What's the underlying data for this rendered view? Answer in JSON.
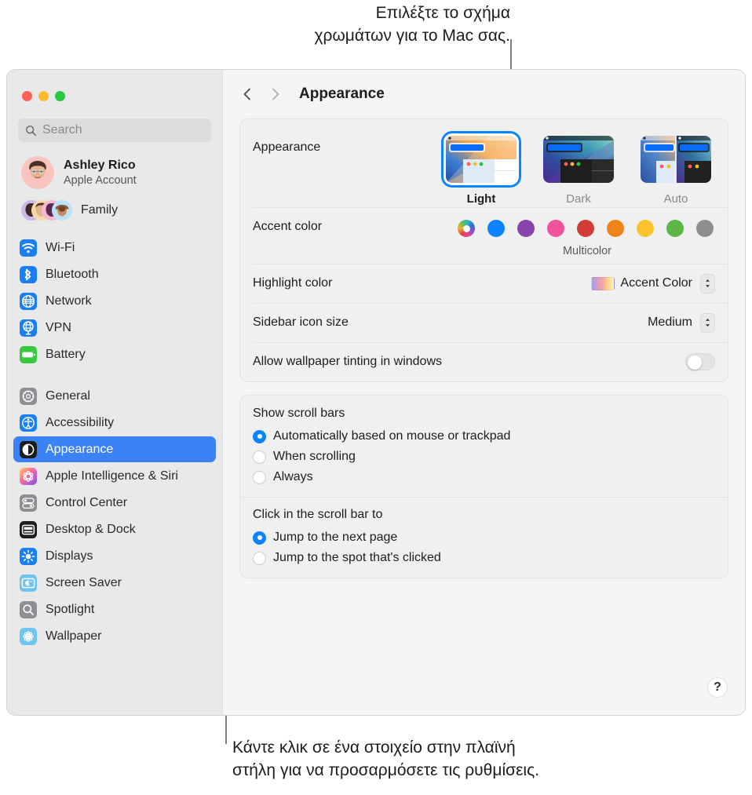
{
  "annotations": {
    "top": "Επιλέξτε το σχήμα\nχρωμάτων για το Mac σας.",
    "bottom": "Κάντε κλικ σε ένα στοιχείο στην πλαϊνή\nστήλη για να προσαρμόσετε τις ρυθμίσεις."
  },
  "window": {
    "traffic_lights": [
      "close-red",
      "minimize-yellow",
      "maximize-green"
    ]
  },
  "sidebar": {
    "search": {
      "placeholder": "Search",
      "value": "",
      "icon": "search-icon"
    },
    "account": {
      "name": "Ashley Rico",
      "subtitle": "Apple Account",
      "avatar": "memoji-avatar"
    },
    "family": {
      "label": "Family",
      "avatar": "family-memoji-stack"
    },
    "groups": [
      {
        "items": [
          {
            "label": "Wi-Fi",
            "icon": "wifi-icon",
            "color": "#1a7ef5",
            "selected": false
          },
          {
            "label": "Bluetooth",
            "icon": "bluetooth-icon",
            "color": "#1a7ef5",
            "selected": false
          },
          {
            "label": "Network",
            "icon": "network-globe-icon",
            "color": "#1a7ef5",
            "selected": false
          },
          {
            "label": "VPN",
            "icon": "vpn-globe-icon",
            "color": "#1a7ef5",
            "selected": false
          },
          {
            "label": "Battery",
            "icon": "battery-icon",
            "color": "#37c840",
            "selected": false
          }
        ]
      },
      {
        "items": [
          {
            "label": "General",
            "icon": "gear-icon",
            "color": "#8e8e93",
            "selected": false
          },
          {
            "label": "Accessibility",
            "icon": "accessibility-icon",
            "color": "#1a7ef5",
            "selected": false
          },
          {
            "label": "Appearance",
            "icon": "appearance-contrast-icon",
            "color": "#1d1d1f",
            "selected": true
          },
          {
            "label": "Apple Intelligence & Siri",
            "icon": "apple-intelligence-icon",
            "color": "#ff4d94",
            "selected": false
          },
          {
            "label": "Control Center",
            "icon": "control-center-icon",
            "color": "#8e8e93",
            "selected": false
          },
          {
            "label": "Desktop & Dock",
            "icon": "desktop-dock-icon",
            "color": "#1d1d1f",
            "selected": false
          },
          {
            "label": "Displays",
            "icon": "brightness-icon",
            "color": "#1a7ef5",
            "selected": false
          },
          {
            "label": "Screen Saver",
            "icon": "screen-saver-icon",
            "color": "#6fc5f0",
            "selected": false
          },
          {
            "label": "Spotlight",
            "icon": "magnifier-icon",
            "color": "#8e8e93",
            "selected": false
          },
          {
            "label": "Wallpaper",
            "icon": "wallpaper-flower-icon",
            "color": "#6fc5f0",
            "selected": false
          }
        ]
      }
    ]
  },
  "toolbar": {
    "back_icon": "chevron-left-icon",
    "forward_icon": "chevron-right-icon",
    "title": "Appearance"
  },
  "appearance_section": {
    "label": "Appearance",
    "options": [
      {
        "name": "Light",
        "selected": true
      },
      {
        "name": "Dark",
        "selected": false
      },
      {
        "name": "Auto",
        "selected": false
      }
    ]
  },
  "accent_section": {
    "label": "Accent color",
    "caption": "Multicolor",
    "swatches": [
      {
        "name": "Multicolor",
        "color": "multicolor",
        "selected": true
      },
      {
        "name": "Blue",
        "color": "#0a84ff",
        "selected": false
      },
      {
        "name": "Purple",
        "color": "#8944ab",
        "selected": false
      },
      {
        "name": "Pink",
        "color": "#f2519e",
        "selected": false
      },
      {
        "name": "Red",
        "color": "#d13b38",
        "selected": false
      },
      {
        "name": "Orange",
        "color": "#f08318",
        "selected": false
      },
      {
        "name": "Yellow",
        "color": "#fcc42b",
        "selected": false
      },
      {
        "name": "Green",
        "color": "#5db545",
        "selected": false
      },
      {
        "name": "Graphite",
        "color": "#8e8e8e",
        "selected": false
      }
    ]
  },
  "highlight_row": {
    "label": "Highlight color",
    "value": "Accent Color",
    "chip": "accent-gradient-chip"
  },
  "sidebar_icon_row": {
    "label": "Sidebar icon size",
    "value": "Medium"
  },
  "tinting_row": {
    "label": "Allow wallpaper tinting in windows",
    "value": "off"
  },
  "scroll_bars": {
    "title": "Show scroll bars",
    "options": [
      {
        "label": "Automatically based on mouse or trackpad",
        "selected": true
      },
      {
        "label": "When scrolling",
        "selected": false
      },
      {
        "label": "Always",
        "selected": false
      }
    ]
  },
  "scroll_click": {
    "title": "Click in the scroll bar to",
    "options": [
      {
        "label": "Jump to the next page",
        "selected": true
      },
      {
        "label": "Jump to the spot that's clicked",
        "selected": false
      }
    ]
  },
  "help": {
    "label": "?"
  }
}
